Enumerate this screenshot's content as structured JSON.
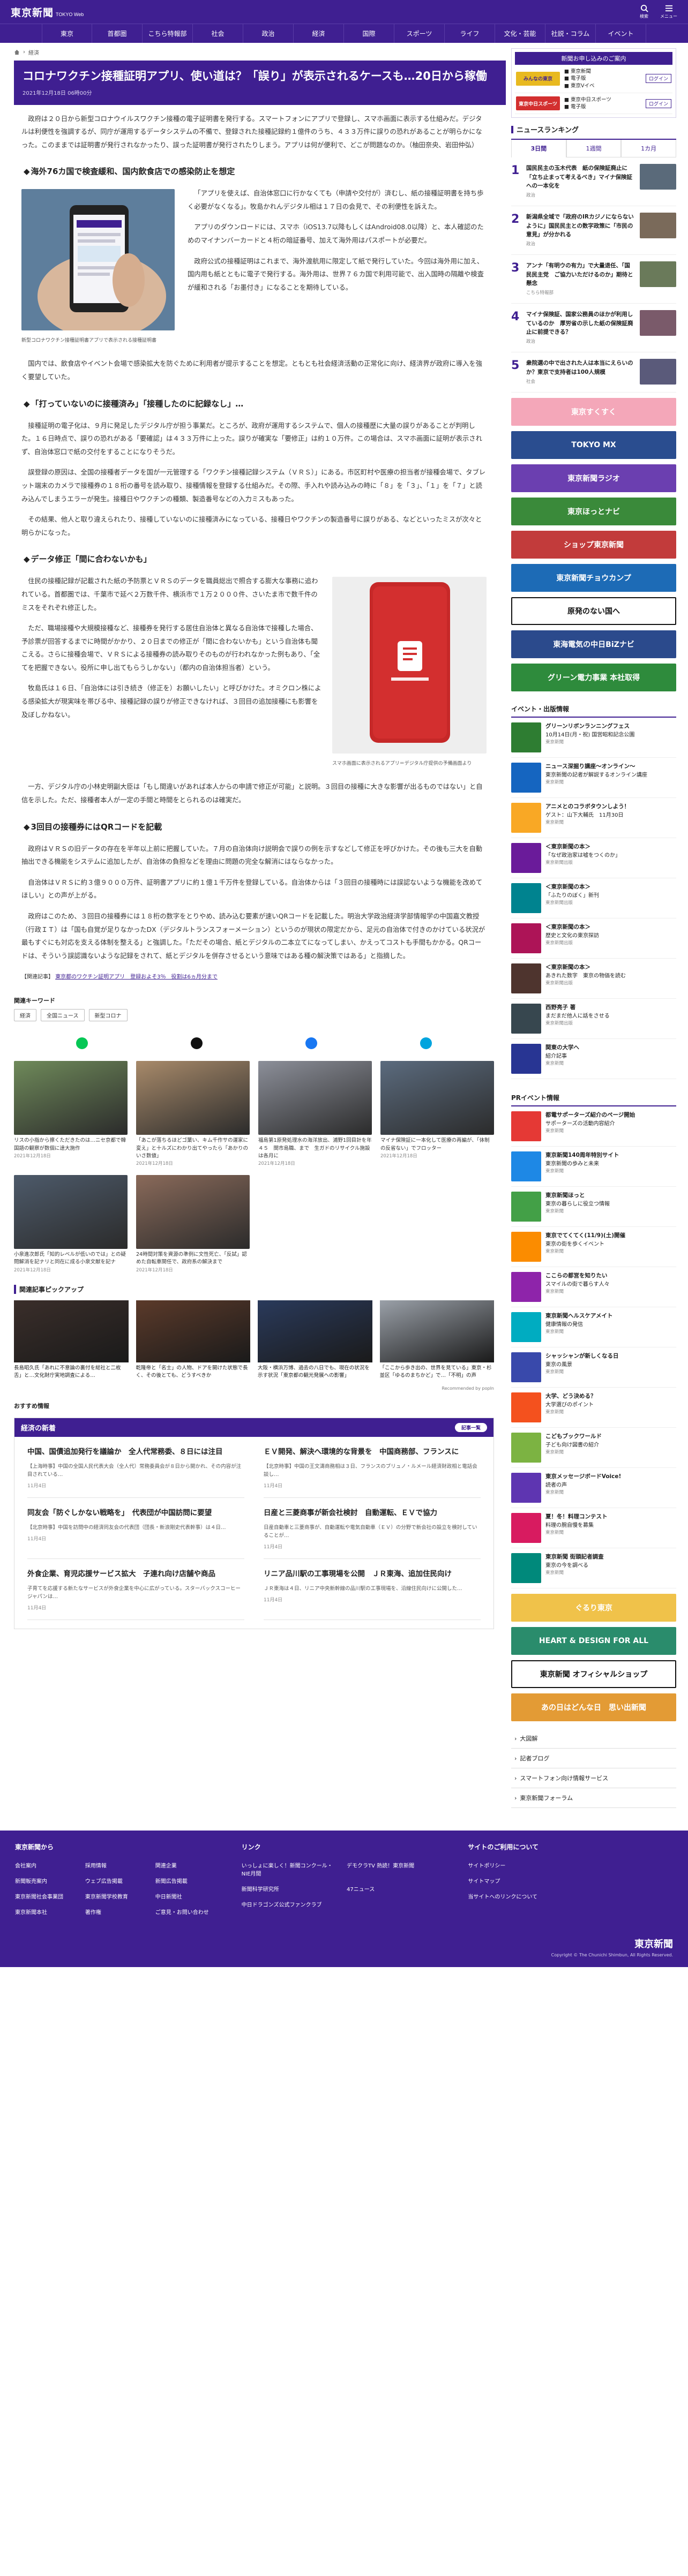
{
  "header": {
    "logo": "東京新聞",
    "logo_sub": "TOKYO Web",
    "icons": [
      {
        "name": "search-icon",
        "label": "検索"
      },
      {
        "name": "menu-icon",
        "label": "メニュー"
      }
    ]
  },
  "nav": [
    "東京",
    "首都圏",
    "こちら特報部",
    "社会",
    "政治",
    "経済",
    "国際",
    "スポーツ",
    "ライフ",
    "文化・芸能",
    "社説・コラム",
    "イベント"
  ],
  "breadcrumb": [
    "経済"
  ],
  "article": {
    "title": "コロナワクチン接種証明アプリ、使い道は？「誤り」が表示されるケースも…20日から稼働",
    "date": "2021年12月18日 06時00分",
    "lead": "政府は２０日から新型コロナウイルスワクチン接種の電子証明書を発行する。スマートフォンにアプリで登録し、スマホ画面に表示する仕組みだ。デジタルは利便性を強調するが、同庁が運用するデータシステムの不備で、登録された接種記録約１億件のうち、４３３万件に誤りの恐れがあることが明らかになった。このままでは証明書が発行されなかったり、誤った証明書が発行されたりしまう。アプリは何が便利で、どこが問題なのか。（柚田奈央、岩田仲弘）",
    "sections": [
      {
        "heading": "海外76カ国で検査緩和、国内飲食店での感染防止を想定",
        "paragraphs": [
          "「アプリを使えば、自治体窓口に行かなくても（申請や交付が）済むし、紙の接種証明書を持ち歩く必要がなくなる」。牧島かれんデジタル相は１７日の会見で、その利便性を訴えた。",
          "アプリのダウンロードには、スマホ（iOS13.7以降もしくはAndroid08.0以降）と、本人確認のためのマイナンバーカードと４桁の暗証番号、加えて海外用はパスポートが必要だ。",
          "政府公式の接種証明はこれまで、海外渡航用に限定して紙で発行していた。今回は海外用に加え、国内用も紙とともに電子で発行する。海外用は、世界７６カ国で利用可能で、出入国時の隔離や検査が緩和される「お墨付き」になることを期待している。",
          "国内では、飲食店やイベント会場で感染拡大を防ぐために利用者が提示することを想定。ともとも社会経済活動の正常化に向け、経済界が政府に導入を強く要望していた。"
        ],
        "figure": {
          "caption": "新型コロナワクチン接種証明書アプリで表示される接種証明書"
        }
      },
      {
        "heading": "「打っていないのに接種済み」「接種したのに記録なし」…",
        "paragraphs": [
          "接種証明の電子化は、９月に発足したデジタル庁が担う事業だ。ところが、政府が運用するシステムで、個人の接種歴に大量の誤りがあることが判明した。１６日時点で、誤りの恐れがある「要確認」は４３３万件に上った。誤りが確実な「要修正」は約１０万件。この場合は、スマホ画面に証明が表示されず、自治体窓口で紙の交付をすることになりそうだ。",
          "誤登録の原因は、全国の接種者データを国が一元管理する「ワクチン接種記録システム（ＶＲＳ）」にある。市区町村や医療の担当者が接種会場で、タブレット端末のカメラで接種券の１８桁の番号を読み取り、接種情報を登録する仕組みだ。その際、手入れや読み込みの時に「８」を「３」、「１」を「７」と読み込んでしまうエラーが発生。接種日やワクチンの種類、製造番号などの入力ミスもあった。",
          "その結果、他人と取り違えられたり、接種していないのに接種済みになっている、接種日やワクチンの製造番号に誤りがある、などといったミスが次々と明らかになった。"
        ]
      },
      {
        "heading": "データ修正「間に合わないかも」",
        "paragraphs": [
          "住民の接種記録が記載された紙の予防票とＶＲＳのデータを職員総出で照合する膨大な事務に追われている。首都圏では、千葉市で延べ２万数千件、横浜市で１万２０００件、さいたま市で数千件のミスをそれぞれ修正した。",
          "ただ、職場接種や大規模接種など、接種券を発行する居住自治体と異なる自治体で接種した場合、予診票が回答するまでに時間がかかり、２０日までの修正が「間に合わないかも」という自治体も聞こえる。さらに接種会場で、ＶＲＳによる接種券の読み取りそのものが行われなかった例もあり、「全てを把握できない。役所に申し出てもらうしかない」（都内の自治体担当者）という。",
          "牧島氏は１６日、「自治体には引き続き（修正を）お願いしたい」と呼びかけた。オミクロン株による感染拡大が現実味を帯びる中、接種記録の誤りが修正できなければ、３回目の追加接種にも影響を及ぼしかねない。",
          "一方、デジタル庁の小林史明副大臣は「もし間違いがあれば本人からの申請で修正が可能」と説明。３回目の接種に大きな影響が出るものではない」と自信を示した。ただ、接種者本人が一定の手間と時間をとられるのは確実だ。"
        ],
        "figure": {
          "caption": "スマホ画面に表示されるアプリ＝デジタル庁提供の予備画面より"
        }
      },
      {
        "heading": "3回目の接種券にはQRコードを記載",
        "paragraphs": [
          "政府はＶＲＳの旧データの存在を半年以上前に把握していた。７月の自治体向け説明会で誤りの例を示すなどして修正を呼びかけた。その後も三大を自動抽出できる機能をシステムに追加したが、自治体の負担などを理由に問題の完全な解消にはならなかった。",
          "自治体はＶＲＳに約３億９０００万件、証明書アプリに約１億１千万件を登録している。自治体からは「３回目の接種時には誤認ないような機能を改めてほしい」との声が上がる。",
          "政府はこのため、３回目の接種券には１８桁の数字をとりやめ、読み込む要素が速いQRコードを記載した。明治大学政治経済学部情報学の中国嘉文教授（行政ＩＴ）は「国も自覚が足りなかったDX（デジタルトランスフォーメーション）というのが現状の限定だから、足元の自治体で付きのかけている状況が最もすぐにも対応を支える体制を整える」と強調した。「ただその場合、紙とデジタルの二本立てになってしまい、かえってコストも手間もかかる。QRコードは、そういう誤認識ないような記録をされて、紙とデジタルを併存させるという意味ではある種の解決策ではある」と指摘した。"
        ]
      }
    ],
    "related_label": "【関連記事】",
    "related_link": "東京都のワクチン証明アプリ　登録およそ3％　役割は6ヵ月分まで"
  },
  "keywords": {
    "title": "関連キーワード",
    "items": [
      "経済",
      "全国ニュース",
      "新型コロナ"
    ]
  },
  "share_icons": [
    "line-share-icon",
    "twitter-share-icon",
    "facebook-share-icon",
    "hatena-share-icon"
  ],
  "thumbs": [
    {
      "caption": "リスの小指から擦くただきたのは…ニセ京都で韓国語の観察が数個に達大施作",
      "date": "2021年12月18日"
    },
    {
      "caption": "「あこが落ちるほどゴ葉い、キム千作サの運家に変え」と十ルズにわかり出てやったら「あかりのいさ数値」",
      "date": "2021年12月18日"
    },
    {
      "caption": "福島第1原発処理水の海洋放出、浦野1回目計を年４５　関市島職、まで　生ガドのリサイクル施設は各月に",
      "date": "2021年12月18日"
    },
    {
      "caption": "マイナ保険証に一本化して医療の再編が、「体制の反省ない」でフロッター",
      "date": "2021年12月18日"
    },
    {
      "caption": "小泉進次郎氏「知的レベルが低いのでは」との疑問解消を記ナリと同在に成る小泉文献を記ナ",
      "date": "2021年12月18日"
    },
    {
      "caption": "24時間対策を資源の準例に文性死亡、「反試」認めた自転車関任で、政府系の解決まで",
      "date": "2021年12月18日"
    }
  ],
  "pickup": {
    "title": "関連記事ピックアップ",
    "items": [
      {
        "caption": "長島昭久氏「あれに不意論の裏付を総社と二枚舌」と…文化財庁実地調査による…"
      },
      {
        "caption": "乾隆帝と「名士」の人物、ドアを開けた状態で長く、その後とても、どうすべきか"
      },
      {
        "caption": "大阪・横浜万博、過去の八日でも、現在の状況を示す状況「東京都の観光発展への影響」"
      },
      {
        "caption": "「ここから歩き出の、世界を見ている」東京・杉並区「ゆるのまちかど」で…「不明」の声"
      }
    ],
    "powered": "Recommended by popIn"
  },
  "recommend_title": "おすすめ情報",
  "latest": {
    "title": "経済の新着",
    "more": "記事一覧",
    "items": [
      {
        "title": "中国、国債追加発行を議論か　全人代常務委、８日には注目",
        "desc": "【上海時事】中国の全国人民代表大会（全人代）常務委員会が８日から開かれ、その内容が注目されている…",
        "date": "11月4日"
      },
      {
        "title": "ＥＶ開発、解決へ環境的な背景を　中国商務部、フランスに",
        "desc": "【北京時事】中国の王文濤商務相は３日、フランスのブリュノ・ルメール経済財政相と電話会談し…",
        "date": "11月4日"
      },
      {
        "title": "同友会「防ぐしかない戦略を」　代表団が中国訪問に要望",
        "desc": "【北京時事】中国を訪問中の経済同友会の代表団（団長・新浪剛史代表幹事）は４日…",
        "date": "11月4日"
      },
      {
        "title": "日産と三菱商事が新会社検討　自動運転、ＥＶで協力",
        "desc": "日産自動車と三菱商事が、自動運転や電気自動車（ＥＶ）の分野で新会社の設立を検討していることが…",
        "date": "11月4日"
      },
      {
        "title": "外食企業、育児応援サービス拡大　子連れ向け店舗や商品",
        "desc": "子育てを応援する新たなサービスが外食企業を中心に広がっている。スターバックスコーヒージャパンは…",
        "date": "11月4日"
      },
      {
        "title": "リニア品川駅の工事現場を公開　ＪＲ東海、追加住民向け",
        "desc": "ＪＲ東海は４日、リニア中央新幹線の品川駅の工事現場を、沿線住民向けに公開した…",
        "date": "11月4日"
      }
    ]
  },
  "side": {
    "promo_title": "新聞お申し込みのご案内",
    "promo_rows": [
      {
        "logo": "みんなの東京",
        "items": [
          "■ 東京新聞",
          "■ 電子版",
          "■ 東京Vイベ"
        ],
        "login": "ログイン"
      },
      {
        "logo": "東京中日スポーツ",
        "items": [
          "■ 東京中日スポーツ",
          "■ 電子版"
        ],
        "login": "ログイン"
      }
    ],
    "ranking_title": "ニュースランキング",
    "ranking_tabs": [
      "3日間",
      "1週間",
      "1カ月"
    ],
    "ranking": [
      {
        "text": "国民民主の玉木代表　紙の保険証廃止に「立ち止まって考えるべき」マイナ保険証への一本化を",
        "cat": "政治"
      },
      {
        "text": "新潟県全域で「政府のIRカジノにならないように」国民民主との数字政策に「市民の意見」が分かれる",
        "cat": "政治"
      },
      {
        "text": "アンナ「有明ウの有力」で大量退任、「国民民主党　ご協力いただけるのか」期待と懸念",
        "cat": "こちら特報部"
      },
      {
        "text": "マイナ保険証、国家公務員のほかが利用しているのか　厚労省の示した紙の保険証廃止に前提できる？",
        "cat": "政治"
      },
      {
        "text": "衆院選の中で出された人は本当にえらいのか？東京で支持者は100人規模",
        "cat": "社会"
      }
    ],
    "banners": [
      {
        "label": "東京すくすく",
        "color": "#f4a7b9"
      },
      {
        "label": "TOKYO MX",
        "color": "#2a4d8f"
      },
      {
        "label": "東京新聞ラジオ",
        "color": "#6b3fb0"
      },
      {
        "label": "東京ほっとナビ",
        "color": "#3a8a3a"
      },
      {
        "label": "ショップ東京新聞",
        "color": "#c23b3b"
      },
      {
        "label": "東京新聞チョウカンプ",
        "color": "#1d6bb6"
      },
      {
        "label": "原発のない国へ",
        "color": "#ffffff"
      },
      {
        "label": "東海電気の中日BiZナビ",
        "color": "#2b4a8c"
      },
      {
        "label": "グリーン電力事業 本社取得",
        "color": "#2e8b3c"
      }
    ],
    "event_title": "イベント・出版情報",
    "events": [
      {
        "title": "グリーンリボンランニングフェス",
        "desc": "10月14日(月・祝) 国営昭和記念公園",
        "src": "東京新聞"
      },
      {
        "title": "ニュース深掘り講座〜オンライン〜",
        "desc": "東京新聞の記者が解説するオンライン講座",
        "src": "東京新聞"
      },
      {
        "title": "アニメとのコラボタウンしよう！",
        "desc": "ゲスト：山下大輔氏　11月30日",
        "src": "東京新聞"
      },
      {
        "title": "＜東京新聞の本＞",
        "desc": "「なぜ政治家は嘘をつくのか」",
        "src": "東京新聞出版"
      },
      {
        "title": "＜東京新聞の本＞",
        "desc": "「ふたりのぼく」新刊",
        "src": "東京新聞出版"
      },
      {
        "title": "＜東京新聞の本＞",
        "desc": "歴史と文化の東京探訪",
        "src": "東京新聞出版"
      },
      {
        "title": "＜東京新聞の本＞",
        "desc": "あきれた数字　東京の物価を読む",
        "src": "東京新聞出版"
      },
      {
        "title": "西野亮子 著",
        "desc": "まだまだ他人に話をさせる",
        "src": "東京新聞出版"
      },
      {
        "title": "関東の大学へ",
        "desc": "紹介記事",
        "src": "東京新聞"
      }
    ],
    "pr_title": "PRイベント情報",
    "pr": [
      {
        "title": "都電サポーターズ紹介のページ開始",
        "desc": "サポーターズの活動内容紹介",
        "src": "東京新聞"
      },
      {
        "title": "東京新聞140周年特別サイト",
        "desc": "東京新聞の歩みと未来",
        "src": "東京新聞"
      },
      {
        "title": "東京新聞ほっと",
        "desc": "東京の暮らしに役立つ情報",
        "src": "東京新聞"
      },
      {
        "title": "東京でてくてく(11/9)(土)開催",
        "desc": "東京の街を歩くイベント",
        "src": "東京新聞"
      },
      {
        "title": "ここらの都営を知りたい",
        "desc": "スマイルの街で暮らす人々",
        "src": "東京新聞"
      },
      {
        "title": "東京新聞へルスケアメイト",
        "desc": "健康情報の発信",
        "src": "東京新聞"
      },
      {
        "title": "シャッシャンが新しくなる日",
        "desc": "東京の風景",
        "src": "東京新聞"
      },
      {
        "title": "大学、どう決める？",
        "desc": "大学選びのポイント",
        "src": "東京新聞"
      },
      {
        "title": "こどもブックワールド",
        "desc": "子ども向け図書の紹介",
        "src": "東京新聞"
      },
      {
        "title": "東京メッセージボードVoice!",
        "desc": "読者の声",
        "src": "東京新聞"
      },
      {
        "title": "夏！冬！料理コンテスト",
        "desc": "料理の腕自慢を募集",
        "src": "東京新聞"
      },
      {
        "title": "東京新聞 街頭記者調査",
        "desc": "東京の今を調べる",
        "src": "東京新聞"
      }
    ],
    "bottom_banners": [
      {
        "label": "ぐるり東京",
        "color": "#f0c24a"
      },
      {
        "label": "HEART & DESIGN FOR ALL",
        "color": "#2a8c6c"
      },
      {
        "label": "東京新聞 オフィシャルショップ",
        "color": "#ffffff"
      },
      {
        "label": "あの日はどんな日　思い出新聞",
        "color": "#e39b35"
      }
    ],
    "accordions": [
      "大図解",
      "記者ブログ",
      "スマートフォン向け情報サービス",
      "東京新聞フォーラム"
    ]
  },
  "footer": {
    "cols": [
      {
        "title": "東京新聞から",
        "links": [
          "会社案内",
          "採用情報",
          "関連企業",
          "新聞販売案内",
          "ウェブ広告掲載",
          "新聞広告掲載",
          "東京新聞社会事業団",
          "東京新聞学校教育",
          "中日新聞社",
          "東京新聞本社",
          "著作権",
          "ご意見・お問い合わせ"
        ]
      },
      {
        "title": "リンク",
        "links": [
          "いっしょに楽しく！新聞コンクール・NIE月間",
          "デモクラTV 熱読！東京新聞",
          "新聞科学研究所",
          "47ニュース",
          "中日ドラゴンズ公式ファンクラブ"
        ]
      },
      {
        "title": "サイトのご利用について",
        "links": [
          "サイトポリシー",
          "サイトマップ",
          "当サイトへのリンクについて"
        ]
      }
    ],
    "logo": "東京新聞",
    "copyright": "Copyright © The Chunichi Shimbun, All Rights Reserved."
  }
}
